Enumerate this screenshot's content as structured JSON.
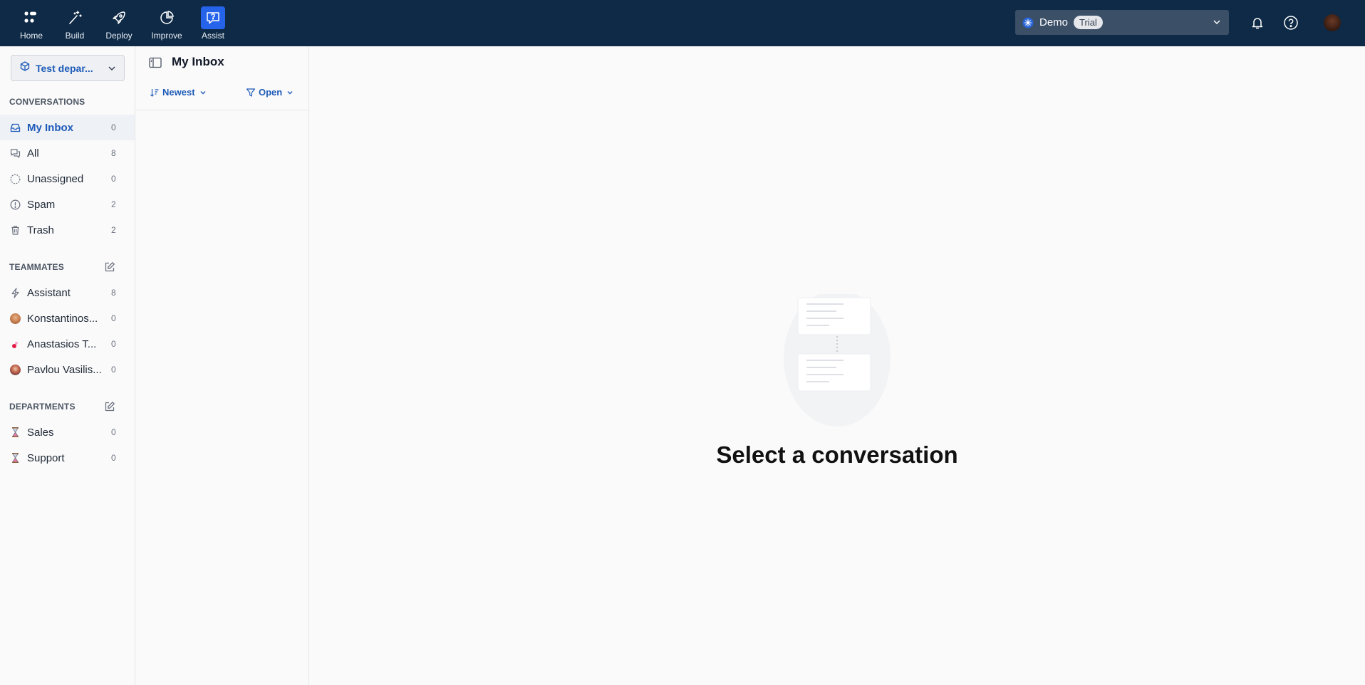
{
  "nav": {
    "items": [
      {
        "label": "Home",
        "icon": "home-icon"
      },
      {
        "label": "Build",
        "icon": "magic-wand-icon"
      },
      {
        "label": "Deploy",
        "icon": "rocket-icon"
      },
      {
        "label": "Improve",
        "icon": "pie-chart-icon"
      },
      {
        "label": "Assist",
        "icon": "chat-question-icon",
        "active": true
      }
    ],
    "accent": "#2563eb",
    "background": "#0f2a46"
  },
  "workspace": {
    "name": "Demo",
    "badge": "Trial"
  },
  "sidebar": {
    "department_select": "Test depar...",
    "conversations_title": "CONVERSATIONS",
    "conversations": [
      {
        "label": "My Inbox",
        "count": "0",
        "icon": "inbox-icon",
        "active": true
      },
      {
        "label": "All",
        "count": "8",
        "icon": "chat-bubbles-icon"
      },
      {
        "label": "Unassigned",
        "count": "0",
        "icon": "user-unassigned-icon"
      },
      {
        "label": "Spam",
        "count": "2",
        "icon": "alert-circle-icon"
      },
      {
        "label": "Trash",
        "count": "2",
        "icon": "trash-icon"
      }
    ],
    "teammates_title": "TEAMMATES",
    "teammates": [
      {
        "label": "Assistant",
        "count": "8",
        "icon": "bolt-icon"
      },
      {
        "label": "Konstantinos...",
        "count": "0",
        "icon": "avatar"
      },
      {
        "label": "Anastasios T...",
        "count": "0",
        "icon": "avatar"
      },
      {
        "label": "Pavlou Vasilis...",
        "count": "0",
        "icon": "avatar"
      }
    ],
    "departments_title": "DEPARTMENTS",
    "departments": [
      {
        "label": "Sales",
        "count": "0",
        "icon": "hourglass-icon"
      },
      {
        "label": "Support",
        "count": "0",
        "icon": "hourglass-icon"
      }
    ]
  },
  "conversation_list": {
    "title": "My Inbox",
    "sort_label": "Newest",
    "filter_label": "Open"
  },
  "main": {
    "empty_title": "Select a conversation"
  }
}
